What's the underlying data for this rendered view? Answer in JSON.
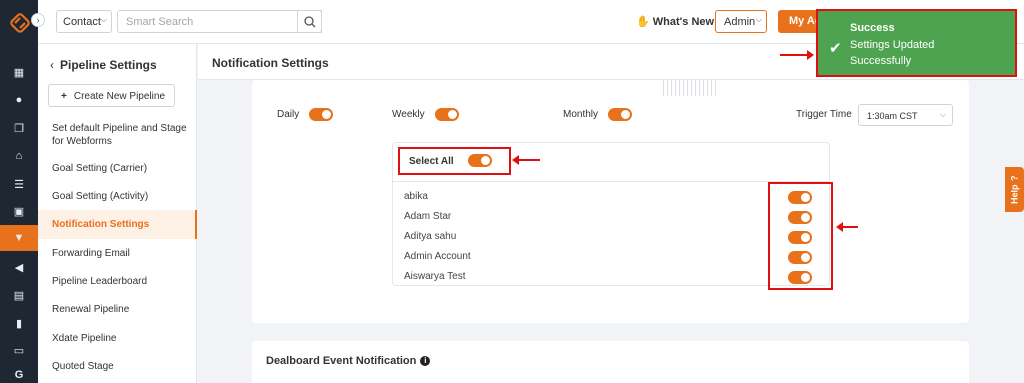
{
  "topbar": {
    "contact_selector": "Contact",
    "search_placeholder": "Smart Search",
    "whats_new": "What's New",
    "whats_new_icon": "hand-pointing-icon",
    "role_selector": "Admin",
    "agent_button": "My Ag"
  },
  "sidebar": {
    "back_label": "Pipeline Settings",
    "create_button": "Create New Pipeline",
    "items": [
      "Set default Pipeline and Stage for Webforms",
      "Goal Setting (Carrier)",
      "Goal Setting (Activity)",
      "Notification Settings",
      "Forwarding Email",
      "Pipeline Leaderboard",
      "Renewal Pipeline",
      "Xdate Pipeline",
      "Quoted Stage"
    ],
    "active_item": "Notification Settings"
  },
  "main": {
    "title": "Notification Settings",
    "frequency": {
      "daily": "Daily",
      "weekly": "Weekly",
      "monthly": "Monthly",
      "daily_on": true,
      "weekly_on": true,
      "monthly_on": true
    },
    "trigger_time_label": "Trigger Time",
    "trigger_time_value": "1:30am CST",
    "select_all_label": "Select All",
    "select_all_on": true,
    "users": [
      {
        "name": "abika",
        "on": true
      },
      {
        "name": "Adam Star",
        "on": true
      },
      {
        "name": "Aditya sahu",
        "on": true
      },
      {
        "name": "Admin Account",
        "on": true
      },
      {
        "name": "Aiswarya Test",
        "on": true
      }
    ],
    "dealboard_title": "Dealboard Event Notification"
  },
  "toast": {
    "title": "Success",
    "message": "Settings Updated Successfully"
  },
  "help_tab": "Help",
  "colors": {
    "accent": "#e8711c",
    "sidebar_dark": "#1f2733",
    "toast_green": "#4ea351",
    "annotation_red": "#e01010"
  }
}
